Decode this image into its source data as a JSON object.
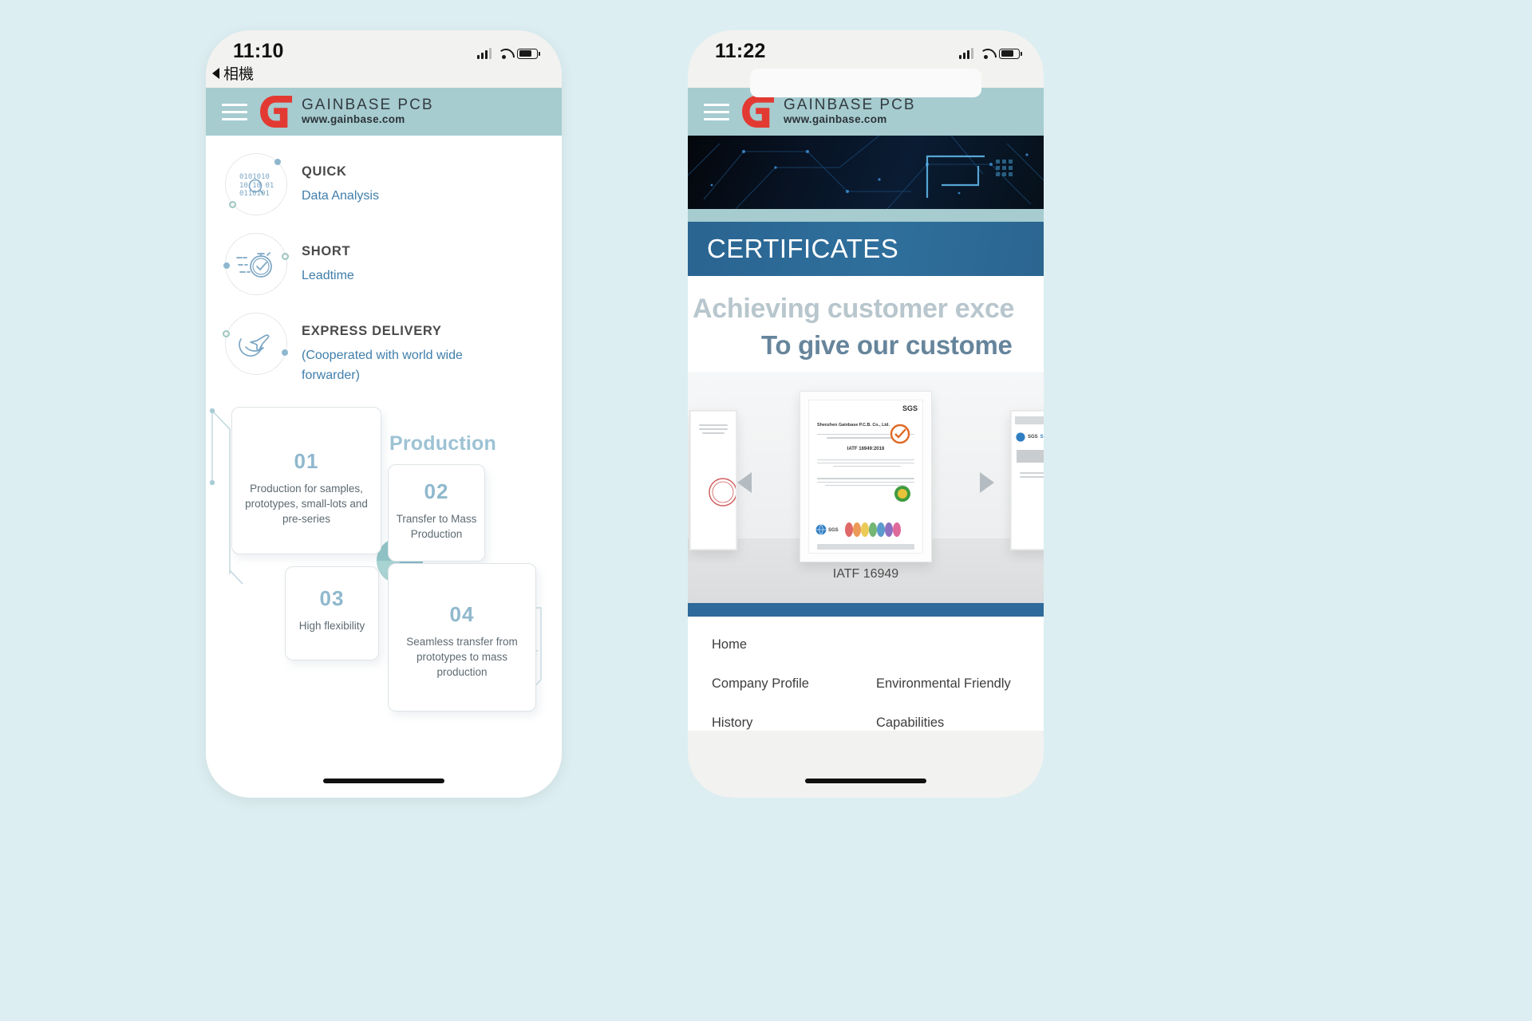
{
  "page": {
    "background_color": "#dceef1"
  },
  "brand": {
    "name": "GAINBASE PCB",
    "url": "www.gainbase.com",
    "logo_color": "#e23a32",
    "header_color": "#a6ccd0"
  },
  "left_phone": {
    "status_bar": {
      "time": "11:10",
      "back_label": "相機",
      "signal_icon": "signal-bars-icon",
      "wifi_icon": "wifi-icon",
      "battery_icon": "battery-icon"
    },
    "menu_icon": "hamburger-menu-icon",
    "features": [
      {
        "icon": "binary-data-analysis-icon",
        "title": "QUICK",
        "subtitle": "Data Analysis"
      },
      {
        "icon": "stopwatch-icon",
        "title": "SHORT",
        "subtitle": "Leadtime"
      },
      {
        "icon": "airplane-delivery-icon",
        "title": "EXPRESS DELIVERY",
        "subtitle": "(Cooperated with world wide forwarder)"
      }
    ],
    "production": {
      "heading": "Production",
      "heading_color": "#9dc2d4",
      "cards": [
        {
          "number": "01",
          "desc": "Production for samples, prototypes, small-lots and pre-series"
        },
        {
          "number": "02",
          "desc": "Transfer to Mass Production"
        },
        {
          "number": "03",
          "desc": "High flexibility"
        },
        {
          "number": "04",
          "desc": "Seamless transfer from prototypes to mass production"
        }
      ]
    }
  },
  "right_phone": {
    "status_bar": {
      "time": "11:22",
      "signal_icon": "signal-bars-icon",
      "wifi_icon": "wifi-icon",
      "battery_icon": "battery-icon"
    },
    "menu_icon": "hamburger-menu-icon",
    "banner": {
      "title": "CERTIFICATES",
      "band_color": "#2f6f9c"
    },
    "slogan": {
      "line1": "Achieving customer exce",
      "line2": "To give our custome"
    },
    "gallery": {
      "prev_icon": "arrow-left-icon",
      "next_icon": "arrow-right-icon",
      "caption": "IATF 16949",
      "certificate_texts": {
        "issuer": "SGS",
        "company": "Shenzhen Gainbase P.C.B. Co., Ltd.",
        "standard": "IATF 16949:2016"
      }
    },
    "footer_nav": [
      {
        "left": "Home",
        "right": ""
      },
      {
        "left": "Company Profile",
        "right": "Environmental Friendly"
      },
      {
        "left": "History",
        "right": "Capabilities"
      }
    ]
  }
}
